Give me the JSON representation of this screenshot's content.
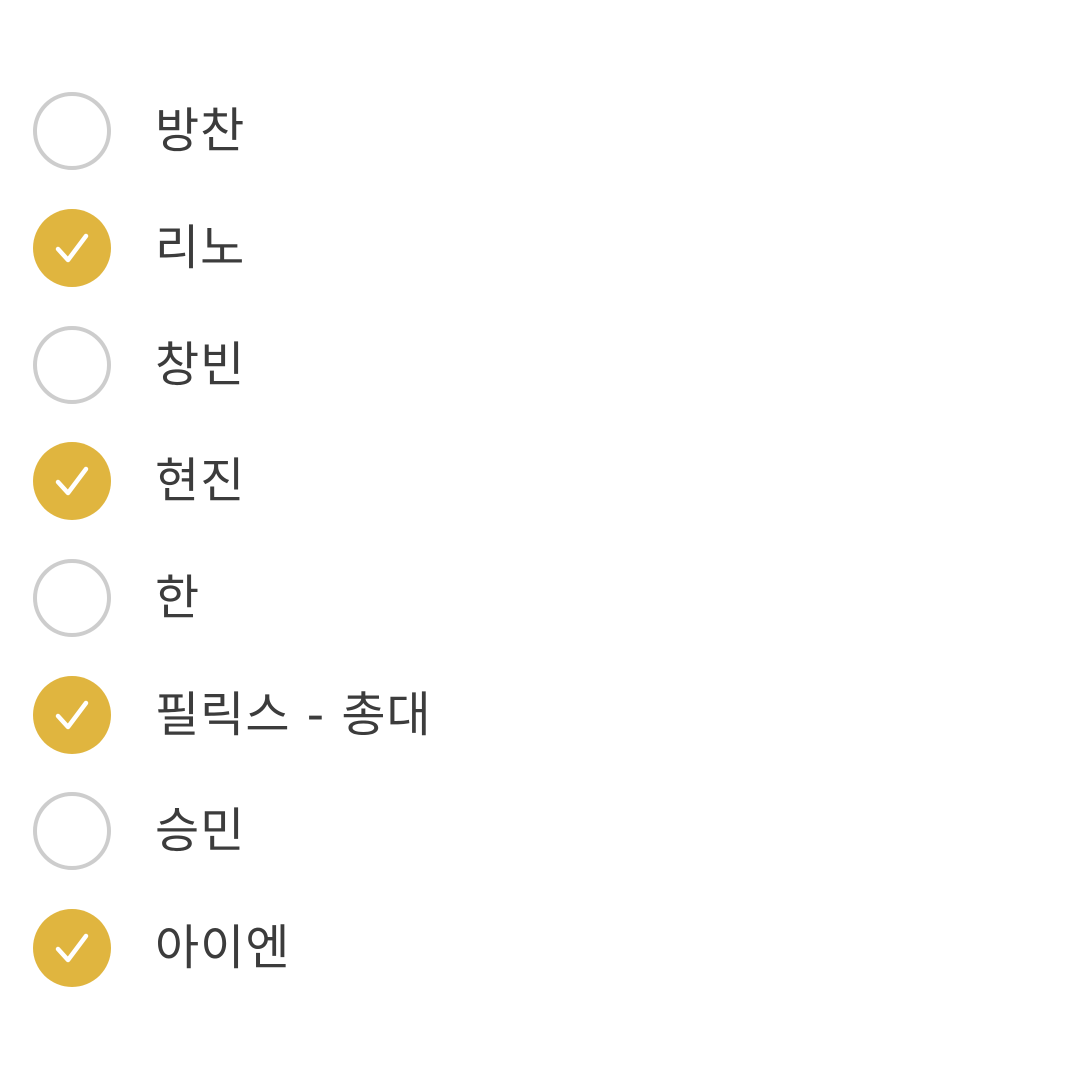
{
  "items": [
    {
      "label": "방찬",
      "checked": false
    },
    {
      "label": "리노",
      "checked": true
    },
    {
      "label": "창빈",
      "checked": false
    },
    {
      "label": "현진",
      "checked": true
    },
    {
      "label": "한",
      "checked": false
    },
    {
      "label": "필릭스 - 총대",
      "checked": true
    },
    {
      "label": "승민",
      "checked": false
    },
    {
      "label": "아이엔",
      "checked": true
    }
  ],
  "colors": {
    "checked_fill": "#e0b53f",
    "unchecked_border": "#cdcdcd",
    "checkmark": "#ffffff",
    "label_text": "#3c3c3c"
  },
  "icons": {
    "checked": "check-icon",
    "unchecked": "empty-circle-icon"
  }
}
